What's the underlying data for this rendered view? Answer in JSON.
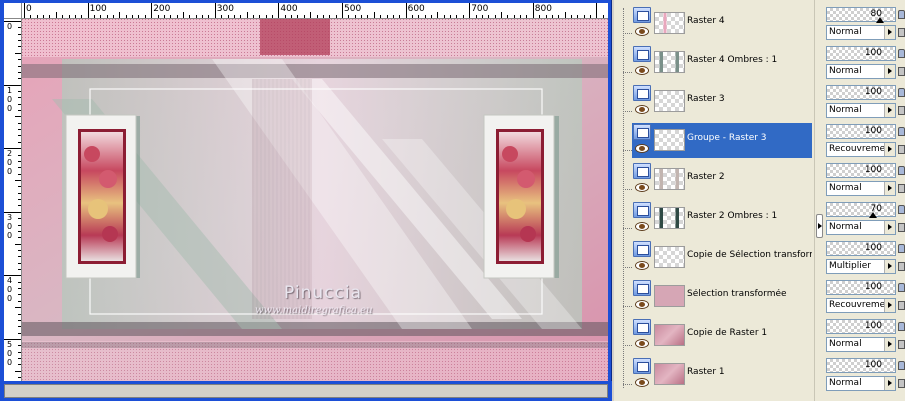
{
  "ruler": {
    "h_labels": [
      "0",
      "100",
      "200",
      "300",
      "400",
      "500",
      "600",
      "700",
      "800"
    ],
    "v_labels": [
      [
        "0"
      ],
      [
        "1",
        "0",
        "0"
      ],
      [
        "2",
        "0",
        "0"
      ],
      [
        "3",
        "0",
        "0"
      ],
      [
        "4",
        "0",
        "0"
      ],
      [
        "5",
        "0",
        "0"
      ]
    ]
  },
  "artwork": {
    "watermark_title": "Pinuccia",
    "watermark_url": "www.maidiregrafica.eu"
  },
  "layers": [
    {
      "name": "Raster 4",
      "opacity": "80",
      "blend": "Normal",
      "selected": false,
      "thumb": "pink-strip"
    },
    {
      "name": "Raster 4 Ombres : 1",
      "opacity": "100",
      "blend": "Normal",
      "selected": false,
      "thumb": "shadow"
    },
    {
      "name": "Raster 3",
      "opacity": "100",
      "blend": "Normal",
      "selected": false,
      "thumb": "empty"
    },
    {
      "name": "Groupe - Raster 3",
      "opacity": "100",
      "blend": "Recouvrement",
      "selected": true,
      "thumb": "empty"
    },
    {
      "name": "Raster 2",
      "opacity": "100",
      "blend": "Normal",
      "selected": false,
      "thumb": "frames"
    },
    {
      "name": "Raster 2 Ombres : 1",
      "opacity": "70",
      "blend": "Normal",
      "selected": false,
      "thumb": "dark-frames"
    },
    {
      "name": "Copie de Sélection transformée",
      "opacity": "100",
      "blend": "Multiplier",
      "selected": false,
      "thumb": "empty"
    },
    {
      "name": "Sélection transformée",
      "opacity": "100",
      "blend": "Recouvrement",
      "selected": false,
      "thumb": "pink-frame"
    },
    {
      "name": "Copie de Raster 1",
      "opacity": "100",
      "blend": "Normal",
      "selected": false,
      "thumb": "pink"
    },
    {
      "name": "Raster 1",
      "opacity": "100",
      "blend": "Normal",
      "selected": false,
      "thumb": "pink"
    }
  ]
}
